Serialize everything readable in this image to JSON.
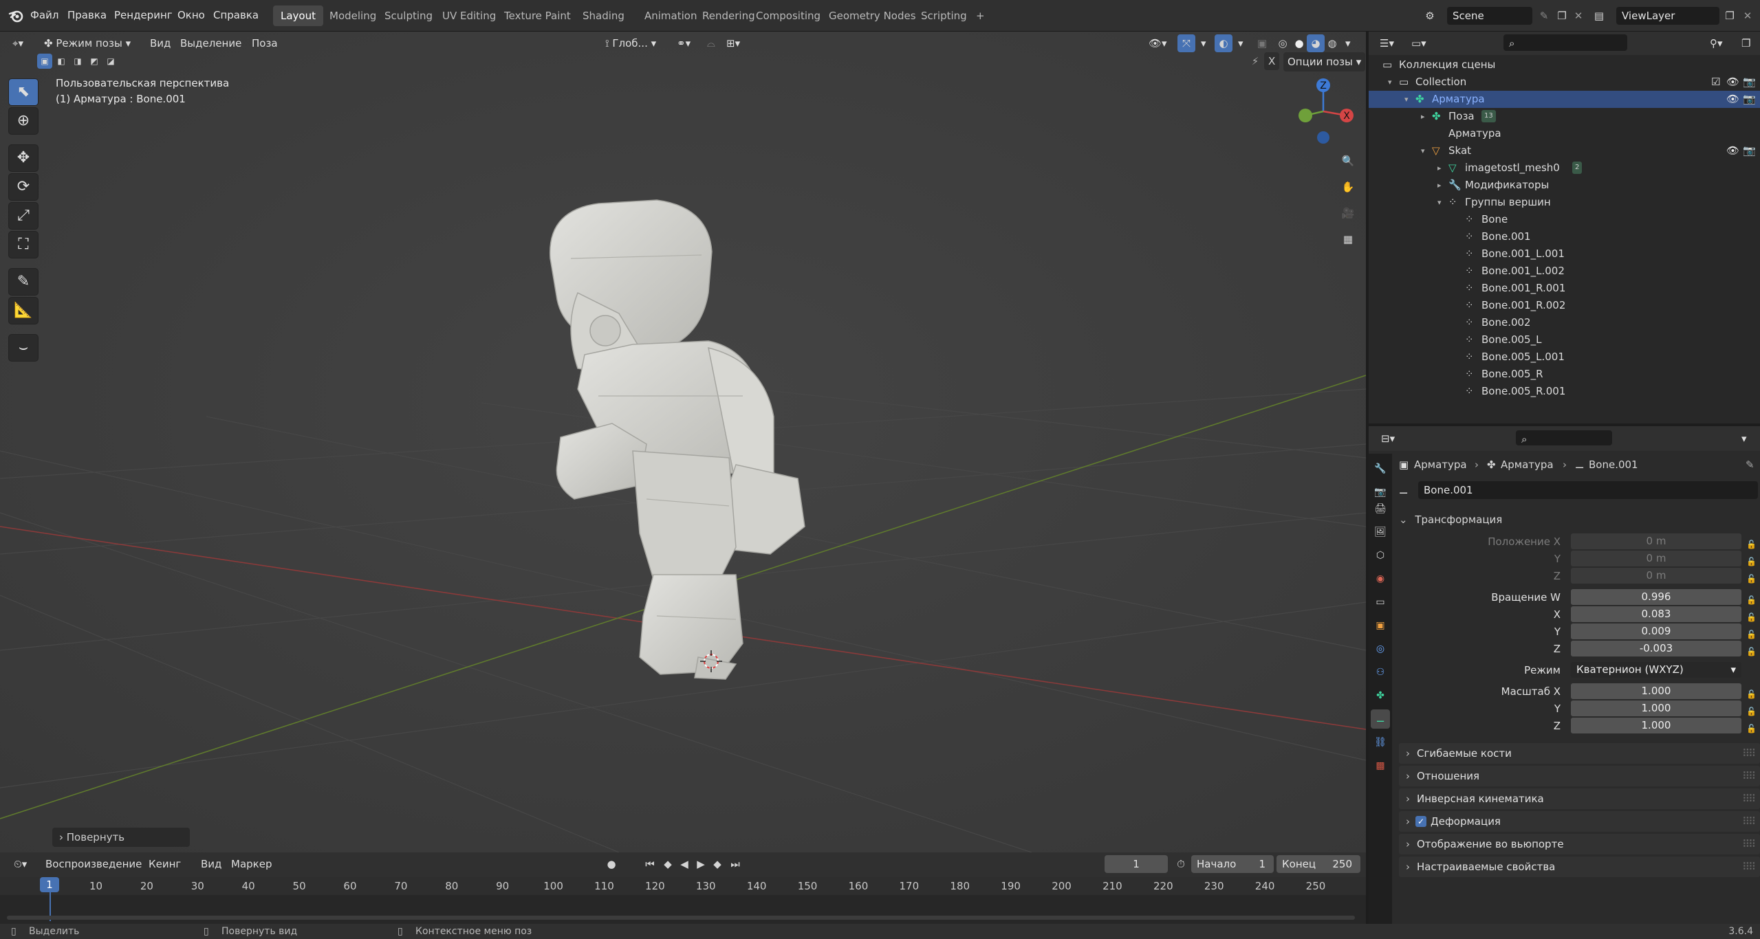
{
  "topbar": {
    "menus": [
      "Файл",
      "Правка",
      "Рендеринг",
      "Окно",
      "Справка"
    ],
    "workspaces": [
      "Layout",
      "Modeling",
      "Sculpting",
      "UV Editing",
      "Texture Paint",
      "Shading",
      "Animation",
      "Rendering",
      "Compositing",
      "Geometry Nodes",
      "Scripting"
    ],
    "active_workspace": "Layout",
    "add_tab": "+",
    "scene": "Scene",
    "view_layer": "ViewLayer"
  },
  "viewport": {
    "mode": "Режим позы",
    "menus": [
      "Вид",
      "Выделение",
      "Поза"
    ],
    "orientation": "Глоб...",
    "pose_options": "Опции позы",
    "x_mirror": "X",
    "overlay_title": "Пользовательская перспектива",
    "overlay_sub": "(1) Арматура : Bone.001",
    "gizmo": {
      "z": "Z",
      "x": "X"
    },
    "last_op": "Повернуть"
  },
  "outliner": {
    "rows": [
      {
        "label": "Коллекция сцены",
        "indent": 0
      },
      {
        "label": "Collection",
        "indent": 1
      },
      {
        "label": "Арматура",
        "indent": 2,
        "selected": true
      },
      {
        "label": "Поза",
        "indent": 3,
        "badge": "13"
      },
      {
        "label": "Арматура",
        "indent": 3
      },
      {
        "label": "Skat",
        "indent": 3
      },
      {
        "label": "imagetostl_mesh0",
        "indent": 4,
        "badge": "2"
      },
      {
        "label": "Модификаторы",
        "indent": 4
      },
      {
        "label": "Группы вершин",
        "indent": 4
      },
      {
        "label": "Bone",
        "indent": 5
      },
      {
        "label": "Bone.001",
        "indent": 5
      },
      {
        "label": "Bone.001_L.001",
        "indent": 5
      },
      {
        "label": "Bone.001_L.002",
        "indent": 5
      },
      {
        "label": "Bone.001_R.001",
        "indent": 5
      },
      {
        "label": "Bone.001_R.002",
        "indent": 5
      },
      {
        "label": "Bone.002",
        "indent": 5
      },
      {
        "label": "Bone.005_L",
        "indent": 5
      },
      {
        "label": "Bone.005_L.001",
        "indent": 5
      },
      {
        "label": "Bone.005_R",
        "indent": 5
      },
      {
        "label": "Bone.005_R.001",
        "indent": 5
      }
    ]
  },
  "properties": {
    "breadcrumb": [
      "Арматура",
      "Арматура",
      "Bone.001"
    ],
    "bone_name": "Bone.001",
    "transform_title": "Трансформация",
    "location": {
      "label": "Положение X",
      "y": "Y",
      "z": "Z",
      "values": [
        "0 m",
        "0 m",
        "0 m"
      ]
    },
    "rotation": {
      "label": "Вращение W",
      "x": "X",
      "y": "Y",
      "z": "Z",
      "values": [
        "0.996",
        "0.083",
        "0.009",
        "-0.003"
      ]
    },
    "mode_label": "Режим",
    "mode_value": "Кватернион (WXYZ)",
    "scale": {
      "label": "Масштаб X",
      "y": "Y",
      "z": "Z",
      "values": [
        "1.000",
        "1.000",
        "1.000"
      ]
    },
    "subpanels": [
      "Сгибаемые кости",
      "Отношения",
      "Инверсная кинематика",
      "Деформация",
      "Отображение во вьюпорте",
      "Настраиваемые свойства"
    ]
  },
  "timeline": {
    "menus": [
      "Воспроизведение",
      "Кеинг",
      "Вид",
      "Маркер"
    ],
    "current_frame": "1",
    "start_label": "Начало",
    "start": "1",
    "end_label": "Конец",
    "end": "250",
    "ruler": [
      "1",
      "10",
      "20",
      "30",
      "40",
      "50",
      "60",
      "70",
      "80",
      "90",
      "100",
      "110",
      "120",
      "130",
      "140",
      "150",
      "160",
      "170",
      "180",
      "190",
      "200",
      "210",
      "220",
      "230",
      "240",
      "250"
    ]
  },
  "statusbar": {
    "items": [
      "Выделить",
      "Повернуть вид",
      "Контекстное меню поз"
    ],
    "version": "3.6.4"
  }
}
